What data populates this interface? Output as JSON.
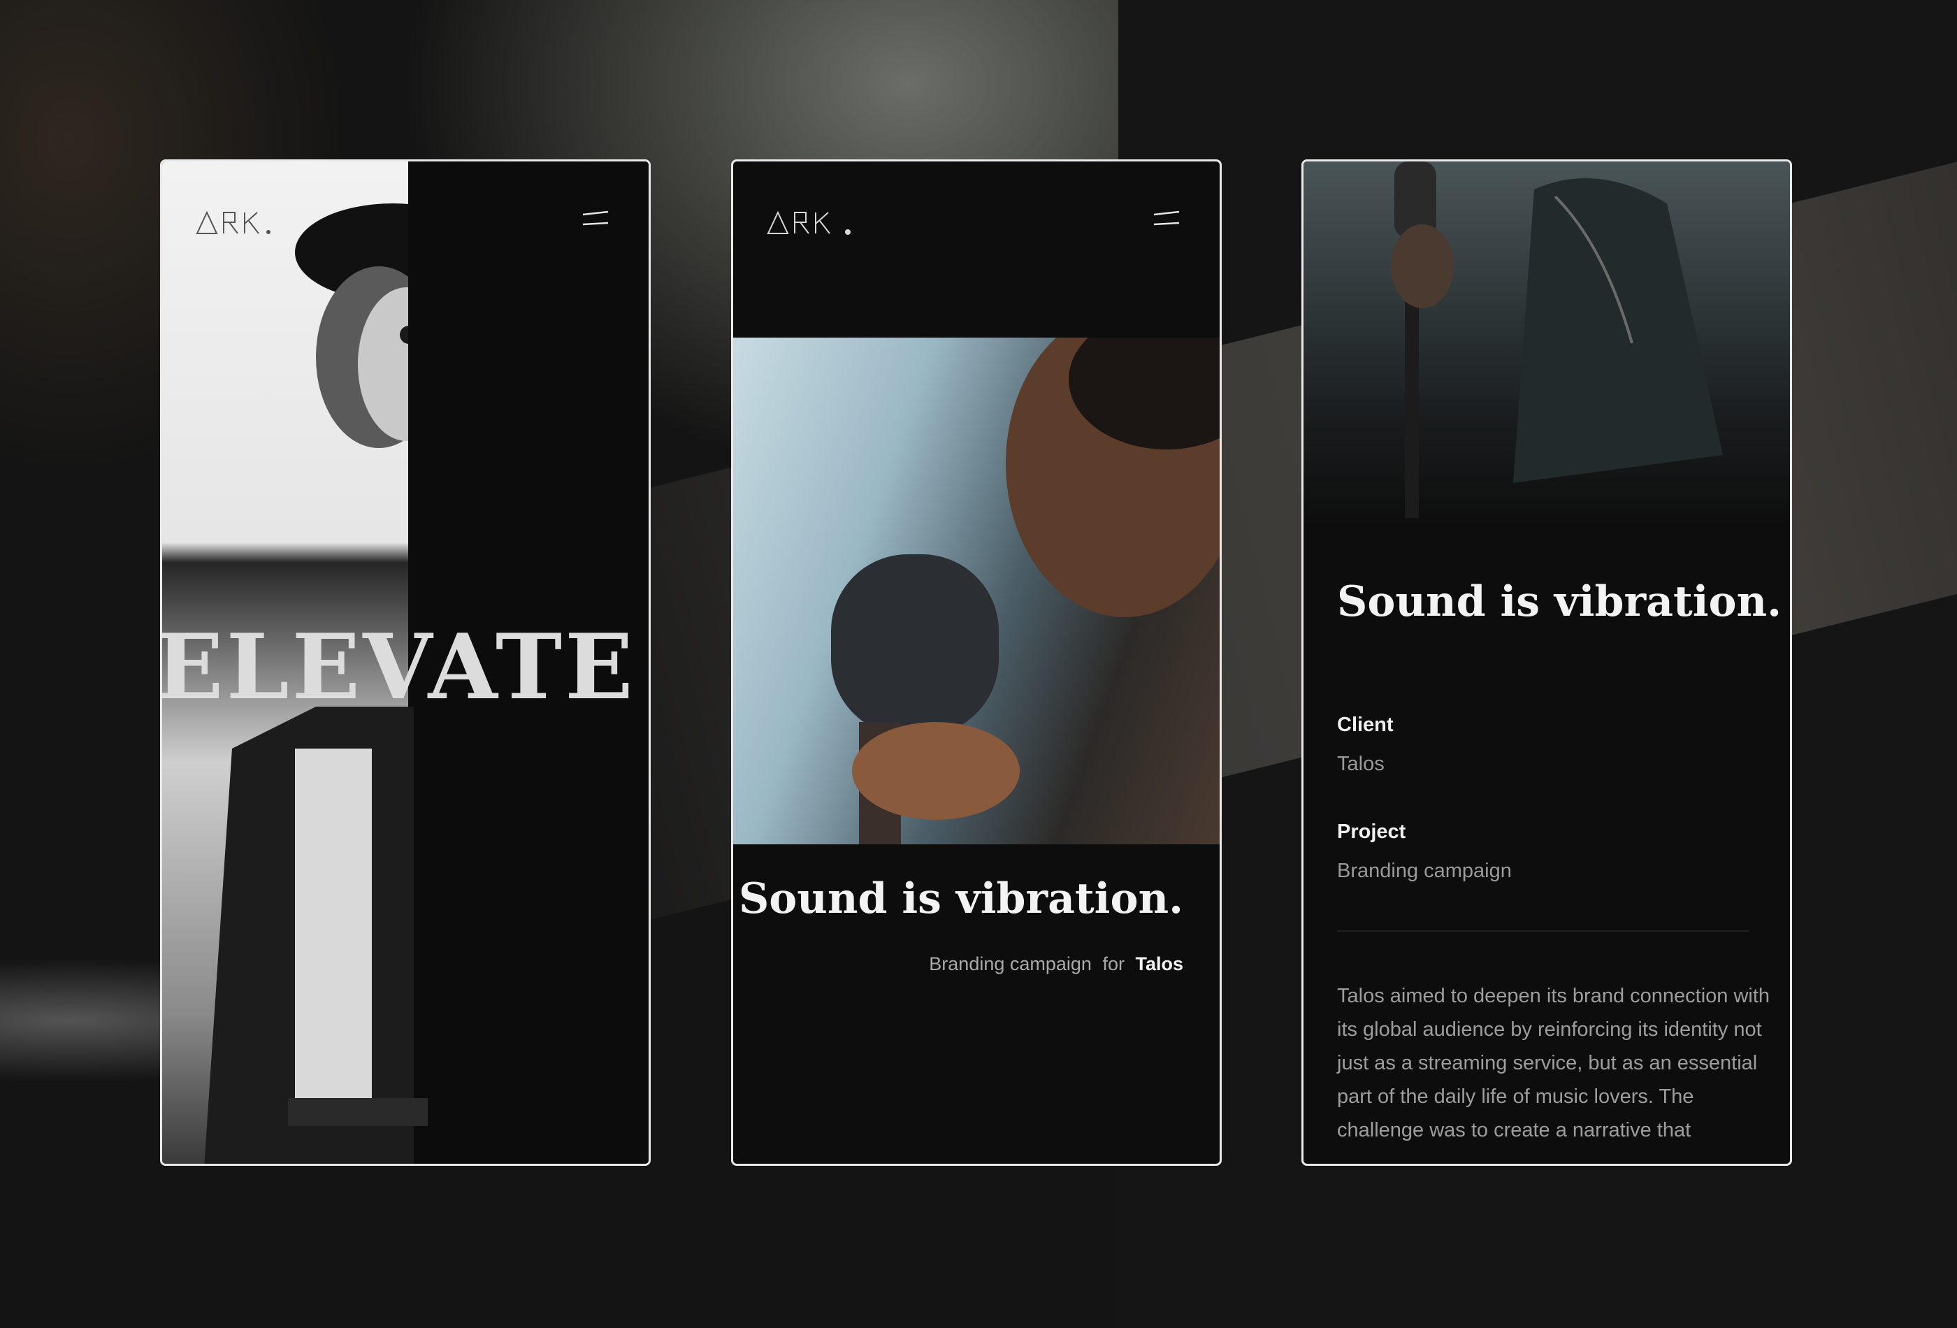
{
  "brand": {
    "logo_text": "ARK",
    "logo_dot": "."
  },
  "screens": {
    "home": {
      "hero_word": "ELEVATE",
      "hero_bullet": "•"
    },
    "project_preview": {
      "title": "Sound is vibration.",
      "subtitle_type": "Branding campaign",
      "subtitle_for": "for",
      "subtitle_client": "Talos"
    },
    "project_detail": {
      "title": "Sound is vibration.",
      "client_label": "Client",
      "client_value": "Talos",
      "project_label": "Project",
      "project_value": "Branding campaign",
      "description": "Talos aimed to deepen its brand connection with its global audience by reinforcing its identity not just as a streaming service, but as an essential part of the daily life of music lovers. The challenge was to create a narrative that"
    }
  },
  "icons": [
    "menu-icon",
    "ark-logo"
  ],
  "colors": {
    "panel_bg": "#0d0d0d",
    "frame_border": "#e9e9e9",
    "text_primary": "#f3f3f3",
    "text_muted": "#9d9d9d"
  }
}
